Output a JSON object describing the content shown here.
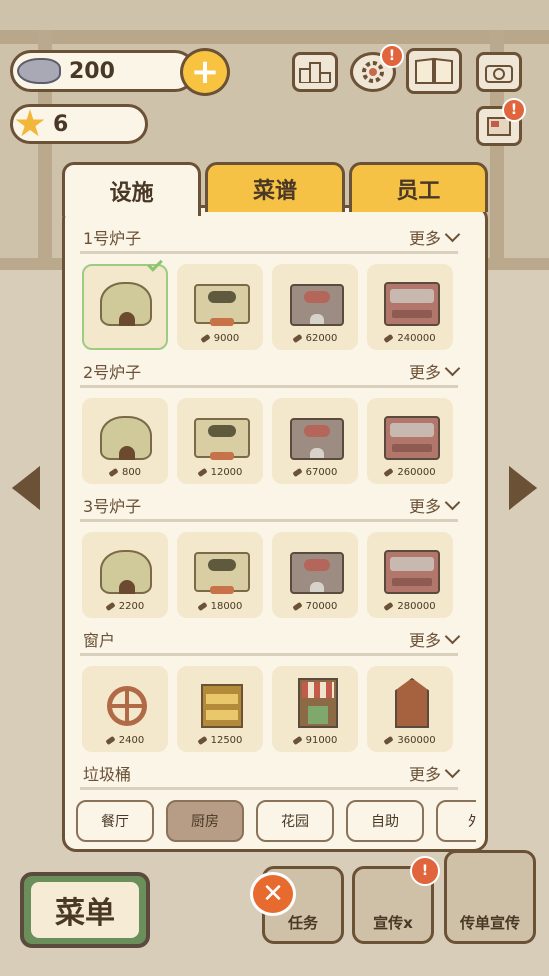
{
  "hud": {
    "fish_count": "200",
    "star_count": "6",
    "plus_label": "+"
  },
  "tabs": [
    {
      "label": "设施",
      "active": true
    },
    {
      "label": "菜谱",
      "active": false
    },
    {
      "label": "员工",
      "active": false
    }
  ],
  "sections": [
    {
      "title": "1号炉子",
      "more": "更多",
      "items": [
        {
          "type": "mound",
          "price": "",
          "owned": true
        },
        {
          "type": "box",
          "price": "9000"
        },
        {
          "type": "metal",
          "price": "62000"
        },
        {
          "type": "range",
          "price": "240000"
        }
      ]
    },
    {
      "title": "2号炉子",
      "more": "更多",
      "items": [
        {
          "type": "mound",
          "price": "800"
        },
        {
          "type": "box",
          "price": "12000"
        },
        {
          "type": "metal",
          "price": "67000"
        },
        {
          "type": "range",
          "price": "260000"
        }
      ]
    },
    {
      "title": "3号炉子",
      "more": "更多",
      "items": [
        {
          "type": "mound",
          "price": "2200"
        },
        {
          "type": "box",
          "price": "18000"
        },
        {
          "type": "metal",
          "price": "70000"
        },
        {
          "type": "range",
          "price": "280000"
        }
      ]
    },
    {
      "title": "窗户",
      "more": "更多",
      "items": [
        {
          "type": "win-round",
          "price": "2400"
        },
        {
          "type": "win-shelf",
          "price": "12500"
        },
        {
          "type": "win-shop",
          "price": "91000"
        },
        {
          "type": "win-house",
          "price": "360000"
        }
      ]
    },
    {
      "title": "垃圾桶",
      "more": "更多",
      "items": []
    }
  ],
  "filters": [
    {
      "label": "餐厅",
      "active": false
    },
    {
      "label": "厨房",
      "active": true
    },
    {
      "label": "花园",
      "active": false
    },
    {
      "label": "自助",
      "active": false
    },
    {
      "label": "外",
      "active": false
    }
  ],
  "bottom": {
    "menu_label": "菜单",
    "task_label": "任务",
    "promo_label": "宣传x",
    "flyer_label": "传单宣传"
  },
  "colors": {
    "accent": "#f6c245",
    "panel": "#fbf5e8",
    "border": "#6b5136",
    "alert": "#e0653c"
  }
}
